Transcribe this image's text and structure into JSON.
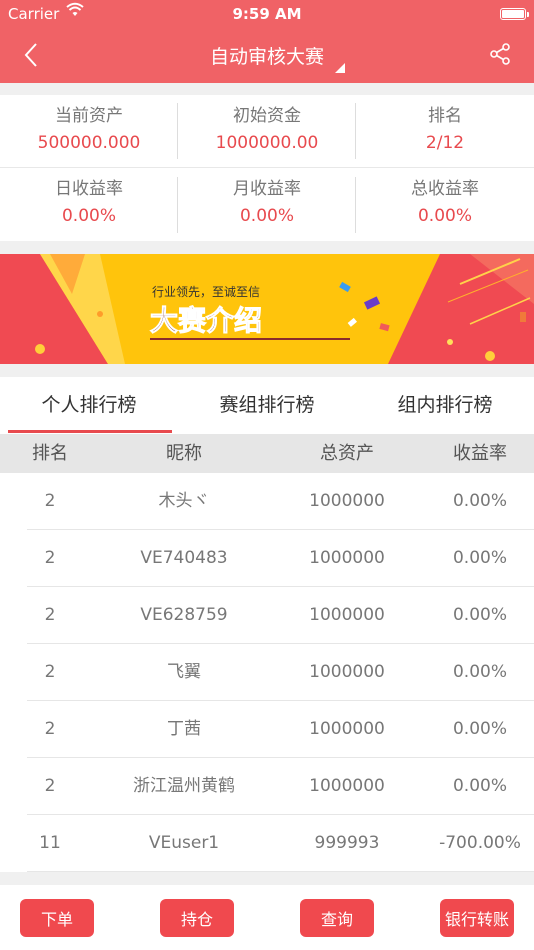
{
  "status_bar": {
    "carrier": "Carrier",
    "time": "9:59 AM"
  },
  "nav": {
    "title": "自动审核大赛"
  },
  "stats": [
    {
      "label": "当前资产",
      "value": "500000.000"
    },
    {
      "label": "初始资金",
      "value": "1000000.00"
    },
    {
      "label": "排名",
      "value": "2/12"
    },
    {
      "label": "日收益率",
      "value": "0.00%"
    },
    {
      "label": "月收益率",
      "value": "0.00%"
    },
    {
      "label": "总收益率",
      "value": "0.00%"
    }
  ],
  "banner": {
    "tagline": "行业领先，至诚至信",
    "heading": "大赛介绍"
  },
  "tabs": [
    {
      "label": "个人排行榜",
      "active": true
    },
    {
      "label": "赛组排行榜",
      "active": false
    },
    {
      "label": "组内排行榜",
      "active": false
    }
  ],
  "table": {
    "headers": [
      "排名",
      "昵称",
      "总资产",
      "收益率"
    ],
    "rows": [
      [
        "2",
        "木头ヾ",
        "1000000",
        "0.00%"
      ],
      [
        "2",
        "VE740483",
        "1000000",
        "0.00%"
      ],
      [
        "2",
        "VE628759",
        "1000000",
        "0.00%"
      ],
      [
        "2",
        "飞翼",
        "1000000",
        "0.00%"
      ],
      [
        "2",
        "丁茜",
        "1000000",
        "0.00%"
      ],
      [
        "2",
        "浙江温州黄鹤",
        "1000000",
        "0.00%"
      ],
      [
        "11",
        "VEuser1",
        "999993",
        "-700.00%"
      ]
    ]
  },
  "bottom_buttons": [
    "下单",
    "持仓",
    "查询",
    "银行转账"
  ],
  "colors": {
    "brand": "#f06266",
    "accent_text": "#e84a4e",
    "button": "#f0494e"
  }
}
